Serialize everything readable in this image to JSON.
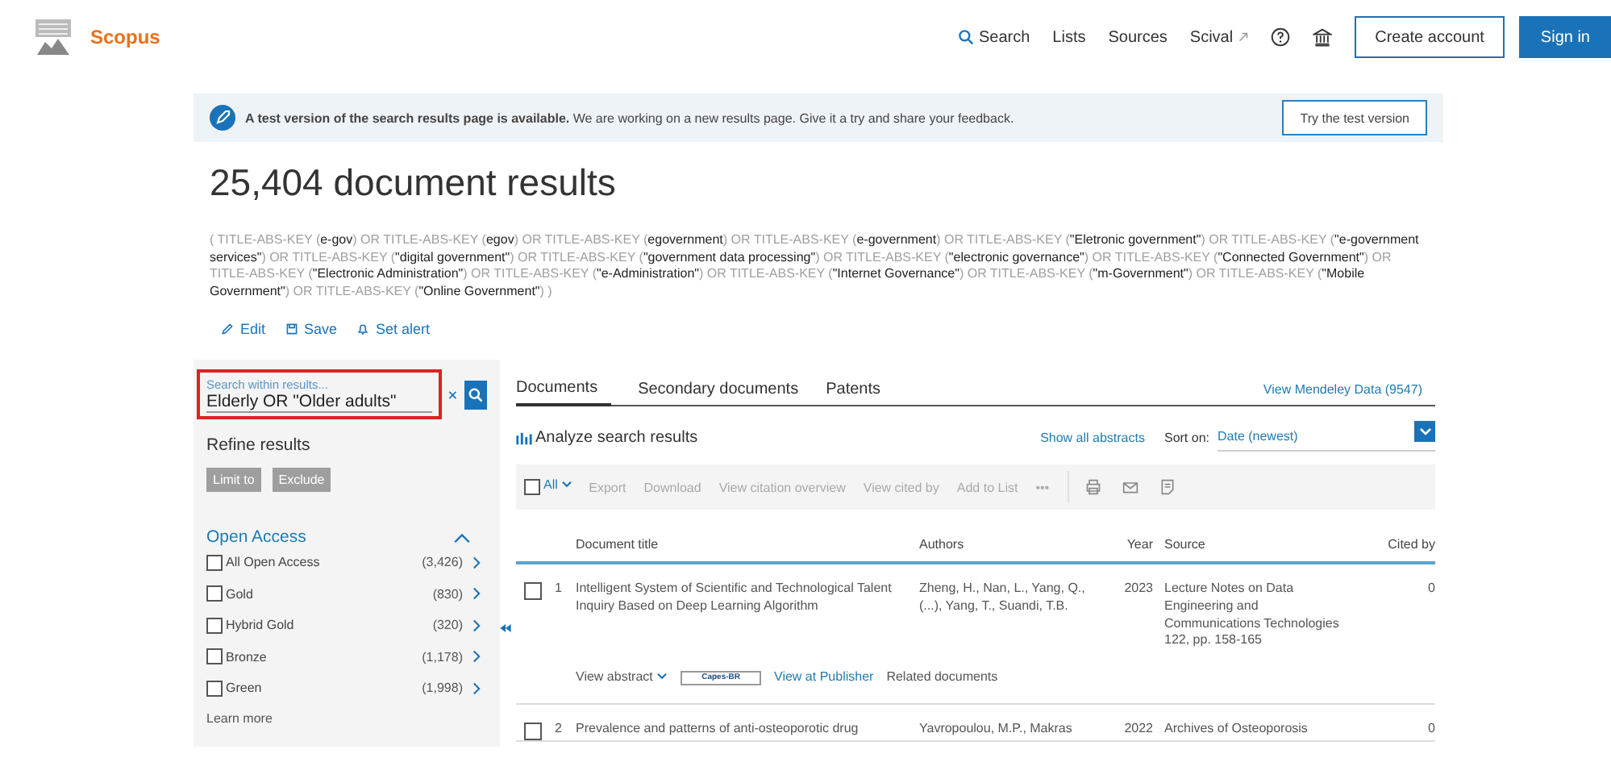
{
  "header": {
    "brand": "Scopus",
    "nav": [
      {
        "label": "Search",
        "kind": "search"
      },
      {
        "label": "Lists",
        "kind": "plain"
      },
      {
        "label": "Sources",
        "kind": "plain"
      },
      {
        "label": "Scival",
        "kind": "external"
      }
    ],
    "buttons": [
      {
        "label": "Create account",
        "kind": "outline"
      },
      {
        "label": "Sign in",
        "kind": "primary"
      }
    ]
  },
  "banner": {
    "bold": "A test version of the search results page is available.",
    "text": "We are working on a new results page. Give it a try and share your feedback.",
    "button": "Try the test version"
  },
  "results_title": "25,404 document results",
  "query": [
    {
      "kind": "key",
      "text": "( TITLE-ABS-KEY ("
    },
    {
      "kind": "term",
      "text": "e-gov"
    },
    {
      "kind": "key",
      "text": ")  OR  TITLE-ABS-KEY ("
    },
    {
      "kind": "term",
      "text": "egov"
    },
    {
      "kind": "key",
      "text": ")  OR  TITLE-ABS-KEY ("
    },
    {
      "kind": "term",
      "text": "egovernment"
    },
    {
      "kind": "key",
      "text": ")  OR  TITLE-ABS-KEY ("
    },
    {
      "kind": "term",
      "text": "e-government"
    },
    {
      "kind": "key",
      "text": ")  OR  TITLE-ABS-KEY ("
    },
    {
      "kind": "term",
      "text": "\"Eletronic government\""
    },
    {
      "kind": "key",
      "text": ")  OR  TITLE-ABS-KEY ("
    },
    {
      "kind": "term",
      "text": "\"e-government services\""
    },
    {
      "kind": "key",
      "text": ")  OR  TITLE-ABS-KEY ("
    },
    {
      "kind": "term",
      "text": "\"digital government\""
    },
    {
      "kind": "key",
      "text": ")  OR  TITLE-ABS-KEY ("
    },
    {
      "kind": "term",
      "text": "\"government data processing\""
    },
    {
      "kind": "key",
      "text": ")  OR  TITLE-ABS-KEY ("
    },
    {
      "kind": "term",
      "text": "\"electronic governance\""
    },
    {
      "kind": "key",
      "text": ")  OR  TITLE-ABS-KEY ("
    },
    {
      "kind": "term",
      "text": "\"Connected Government\""
    },
    {
      "kind": "key",
      "text": ")  OR  TITLE-ABS-KEY ("
    },
    {
      "kind": "term",
      "text": "\"Electronic Administration\""
    },
    {
      "kind": "key",
      "text": ")  OR  TITLE-ABS-KEY ("
    },
    {
      "kind": "term",
      "text": "\"e-Administration\""
    },
    {
      "kind": "key",
      "text": ")  OR  TITLE-ABS-KEY ("
    },
    {
      "kind": "term",
      "text": "\"Internet Governance\""
    },
    {
      "kind": "key",
      "text": ")  OR  TITLE-ABS-KEY ("
    },
    {
      "kind": "term",
      "text": "\"m-Government\""
    },
    {
      "kind": "key",
      "text": ")  OR  TITLE-ABS-KEY ("
    },
    {
      "kind": "term",
      "text": "\"Mobile Government\""
    },
    {
      "kind": "key",
      "text": ")  OR  TITLE-ABS-KEY ("
    },
    {
      "kind": "term",
      "text": "\"Online Government\""
    },
    {
      "kind": "key",
      "text": ") )"
    }
  ],
  "query_actions": [
    {
      "label": "Edit",
      "kind": "edit"
    },
    {
      "label": "Save",
      "kind": "save"
    },
    {
      "label": "Set alert",
      "kind": "alert"
    }
  ],
  "sidebar": {
    "search": {
      "placeholder": "Search within results...",
      "value": "Elderly OR \"Older adults\"",
      "highlighted": true
    },
    "refine_title": "Refine results",
    "refine_buttons": [
      {
        "label": "Limit to",
        "disabled": true
      },
      {
        "label": "Exclude",
        "disabled": true
      }
    ],
    "facet": {
      "title": "Open Access",
      "expanded": true,
      "options": [
        {
          "label": "All Open Access",
          "count": "(3,426)",
          "checked": false
        },
        {
          "label": "Gold",
          "count": "(830)",
          "checked": false
        },
        {
          "label": "Hybrid Gold",
          "count": "(320)",
          "checked": false
        },
        {
          "label": "Bronze",
          "count": "(1,178)",
          "checked": false
        },
        {
          "label": "Green",
          "count": "(1,998)",
          "checked": false
        }
      ]
    },
    "learn_more": "Learn more"
  },
  "main": {
    "tabs": [
      {
        "label": "Documents",
        "selected": true
      },
      {
        "label": "Secondary documents",
        "selected": false
      },
      {
        "label": "Patents",
        "selected": false
      }
    ],
    "mendeley": "View Mendeley Data (9547)",
    "analyze": "Analyze search results",
    "show_abstracts": "Show all abstracts",
    "sort_label": "Sort on:",
    "sort_value": "Date (newest)",
    "toolbar": {
      "all_label": "All",
      "all_checked": false,
      "actions": [
        "Export",
        "Download",
        "View citation overview",
        "View cited by",
        "Add to List",
        "•••"
      ]
    },
    "columns": [
      "Document title",
      "Authors",
      "Year",
      "Source",
      "Cited by"
    ],
    "rows": [
      {
        "number": "1",
        "checked": false,
        "title": "Intelligent System of Scientific and Technological Talent Inquiry Based on Deep Learning Algorithm",
        "authors": "Zheng, H., Nan, L., Yang, Q., (...), Yang, T., Suandi, T.B.",
        "year": "2023",
        "source": "Lecture Notes on Data Engineering and Communications Technologies 122, pp. 158-165",
        "cited_by": "0",
        "links": {
          "abstract": "View abstract",
          "badge": "Capes-BR",
          "publisher": "View at Publisher",
          "related": "Related documents"
        }
      },
      {
        "number": "2",
        "checked": false,
        "title": "Prevalence and patterns of anti-osteoporotic drug",
        "authors": "Yavropoulou, M.P., Makras",
        "year": "2022",
        "source": "Archives of Osteoporosis",
        "cited_by": "0"
      }
    ]
  }
}
